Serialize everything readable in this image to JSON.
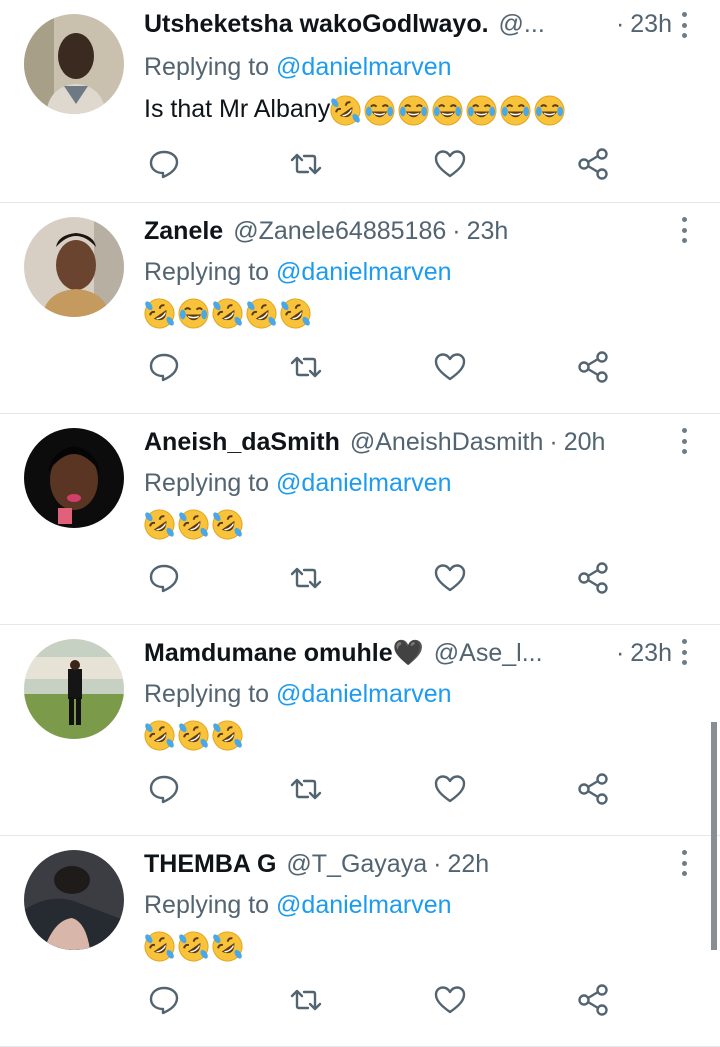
{
  "replying_prefix": "Replying to",
  "colors": {
    "accent": "#1d9bf0",
    "muted": "#536471",
    "text": "#0f1419"
  },
  "icons": {
    "reply": "reply-icon",
    "retweet": "retweet-icon",
    "like": "heart-icon",
    "share": "share-icon",
    "more": "more-icon"
  },
  "tweets": [
    {
      "name": "Utsheketsha wakoGodlwayo.",
      "handle": "@...",
      "time": "23h",
      "mention": "@danielmarven",
      "text": "Is that Mr Albany",
      "emojis": [
        "rofl",
        "joy",
        "joy",
        "joy",
        "joy",
        "joy",
        "joy"
      ]
    },
    {
      "name": "Zanele",
      "handle": "@Zanele64885186",
      "time": "23h",
      "mention": "@danielmarven",
      "text": "",
      "emojis": [
        "rofl",
        "joy",
        "rofl",
        "rofl",
        "rofl"
      ]
    },
    {
      "name": "Aneish_daSmith",
      "handle": "@AneishDasmith",
      "time": "20h",
      "mention": "@danielmarven",
      "text": "",
      "emojis": [
        "rofl",
        "rofl",
        "rofl"
      ]
    },
    {
      "name": "Mamdumane omuhle🖤",
      "handle": "@Ase_l...",
      "time": "23h",
      "mention": "@danielmarven",
      "text": "",
      "emojis": [
        "rofl",
        "rofl",
        "rofl"
      ]
    },
    {
      "name": "THEMBA G",
      "handle": "@T_Gayaya",
      "time": "22h",
      "mention": "@danielmarven",
      "text": "",
      "emojis": [
        "rofl",
        "rofl",
        "rofl"
      ]
    }
  ]
}
